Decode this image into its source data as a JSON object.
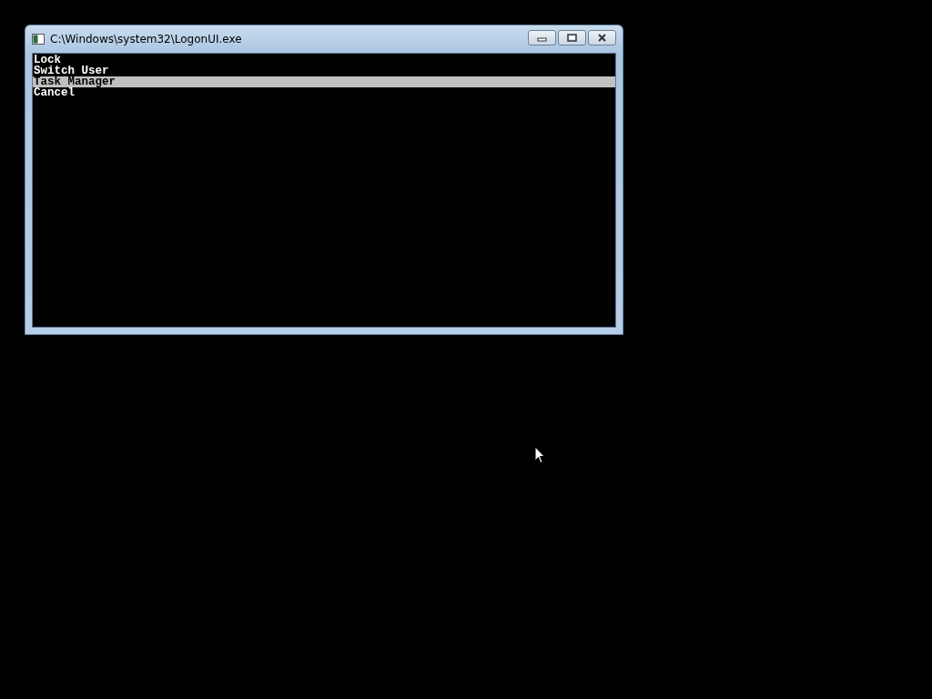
{
  "window": {
    "title": "C:\\Windows\\system32\\LogonUI.exe"
  },
  "menu": [
    {
      "label": "Lock",
      "selected": false
    },
    {
      "label": "Switch User",
      "selected": false
    },
    {
      "label": "Task Manager",
      "selected": true
    },
    {
      "label": "Cancel",
      "selected": false
    }
  ]
}
